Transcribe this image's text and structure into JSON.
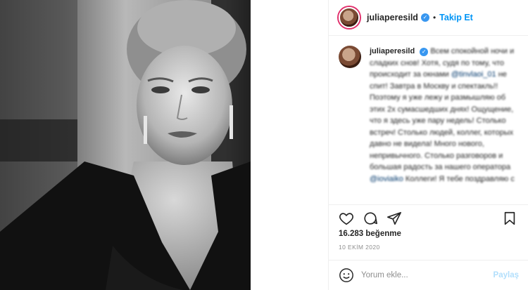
{
  "post": {
    "username": "juliaperesild",
    "follow_label": "Takip Et",
    "separator": "•"
  },
  "caption": {
    "username": "juliaperesild",
    "text_1": "Всем спокойной ночи",
    "text_2": "и сладких снов! Хотя, судя по тому, что происходит за окнами",
    "mention_1": "@tinvlaoi_01",
    "text_3": "не спит! Завтра в Москву и спектакль!! Поэтому я уже лежу и размышляю об этих 2х сумасшедших днях! Ощущение, что я здесь уже пару недель! Столько встреч! Столько людей, коллег, которых давно не видела! Много нового, непривычного. Столько разговоров и большая радость за нашего оператора",
    "mention_2": "@ioviaiko",
    "text_4": "Коллеги! Я тебе поздравляю с"
  },
  "likes": "16.283 beğenme",
  "date": "10 EKİM 2020",
  "comment": {
    "placeholder": "Yorum ekle...",
    "post_label": "Paylaş"
  },
  "icons": {
    "verified": "verified-badge-icon",
    "heart": "heart-icon",
    "comment": "comment-icon",
    "share": "share-icon",
    "bookmark": "bookmark-icon",
    "emoji": "emoji-icon"
  },
  "colors": {
    "accent": "#0095f6",
    "verified": "#3897f0",
    "text": "#262626",
    "muted": "#8e8e8e",
    "post_disabled": "#b2dffc"
  }
}
